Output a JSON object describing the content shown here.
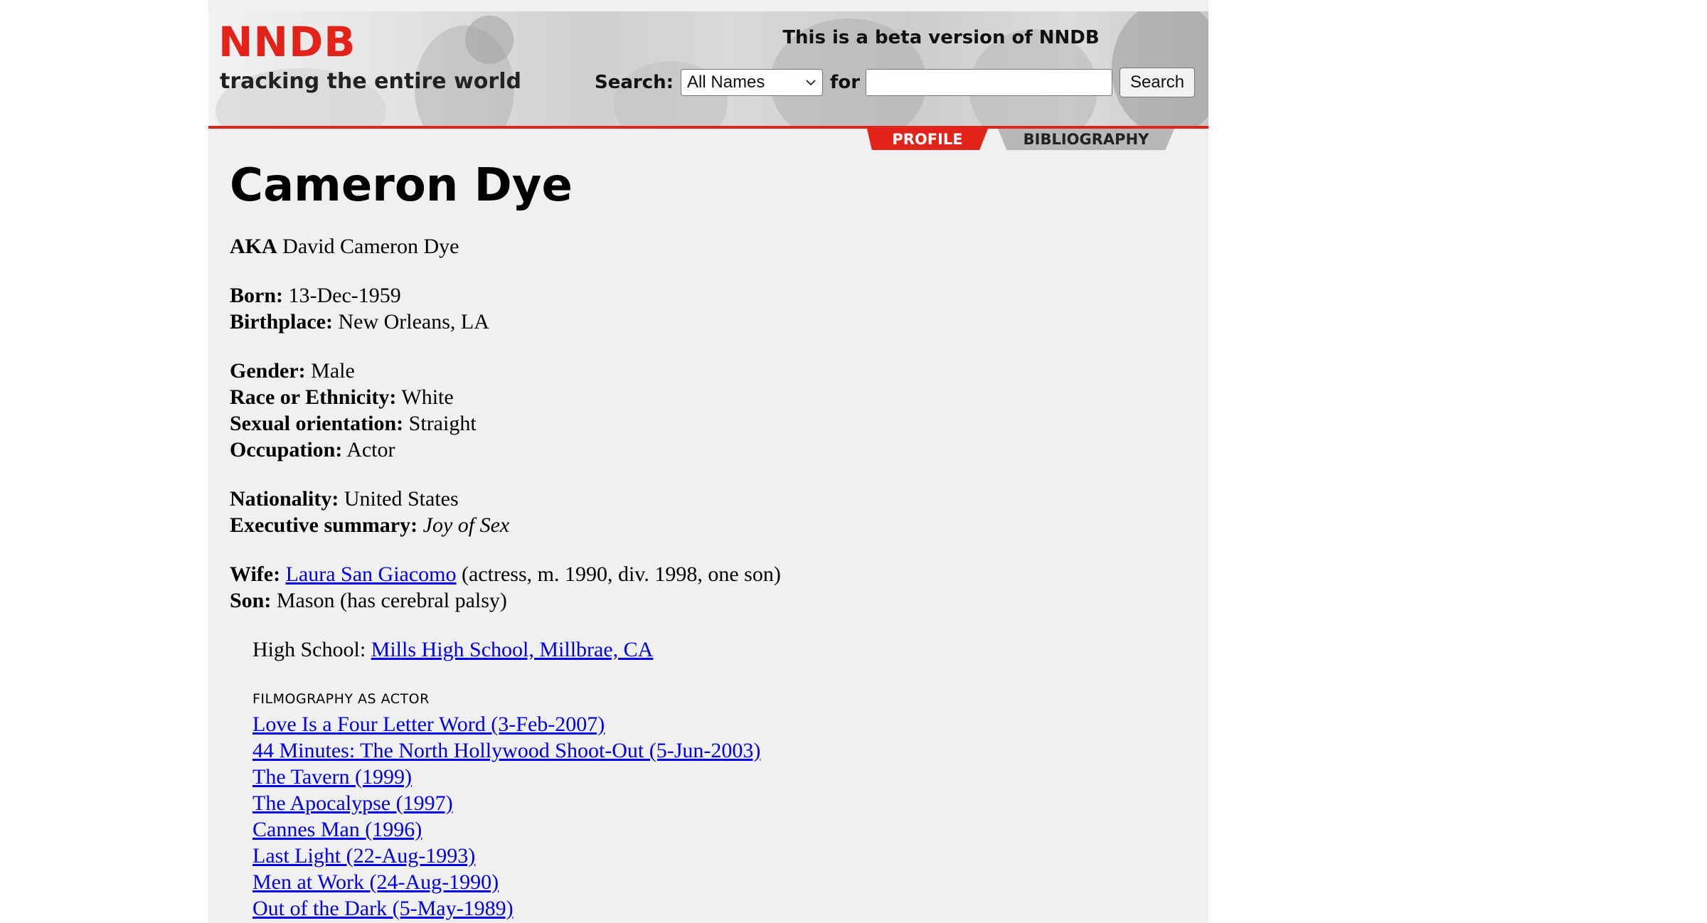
{
  "header": {
    "logo": "NNDB",
    "tagline": "tracking the entire world",
    "beta_notice": "This is a beta version of NNDB",
    "search_label": "Search:",
    "search_scope": "All Names",
    "for_label": "for",
    "search_value": "",
    "search_button": "Search"
  },
  "tabs": [
    {
      "label": "PROFILE",
      "active": true
    },
    {
      "label": "BIBLIOGRAPHY",
      "active": false
    }
  ],
  "profile": {
    "name": "Cameron Dye",
    "aka_label": "AKA",
    "aka": "David Cameron Dye",
    "born_label": "Born:",
    "born": "13-Dec-1959",
    "birthplace_label": "Birthplace:",
    "birthplace": "New Orleans, LA",
    "gender_label": "Gender:",
    "gender": "Male",
    "race_label": "Race or Ethnicity:",
    "race": "White",
    "orientation_label": "Sexual orientation:",
    "orientation": "Straight",
    "occupation_label": "Occupation:",
    "occupation": "Actor",
    "nationality_label": "Nationality:",
    "nationality": "United States",
    "summary_label": "Executive summary:",
    "summary": "Joy of Sex",
    "wife_label": "Wife:",
    "wife_name": "Laura San Giacomo",
    "wife_detail": "(actress, m. 1990, div. 1998, one son)",
    "son_label": "Son:",
    "son_detail": "Mason (has cerebral palsy)",
    "highschool_label": "High School:",
    "highschool": "Mills High School, Millbrae, CA"
  },
  "filmography": {
    "heading": "FILMOGRAPHY AS ACTOR",
    "items": [
      "Love Is a Four Letter Word (3-Feb-2007)",
      "44 Minutes: The North Hollywood Shoot-Out (5-Jun-2003)",
      "The Tavern (1999)",
      "The Apocalypse (1997)",
      "Cannes Man (1996)",
      "Last Light (22-Aug-1993)",
      "Men at Work (24-Aug-1990)",
      "Out of the Dark (5-May-1989)"
    ]
  },
  "colors": {
    "brand_red": "#e2231a",
    "page_bg": "#f0f0f0",
    "link": "#0000ee"
  }
}
